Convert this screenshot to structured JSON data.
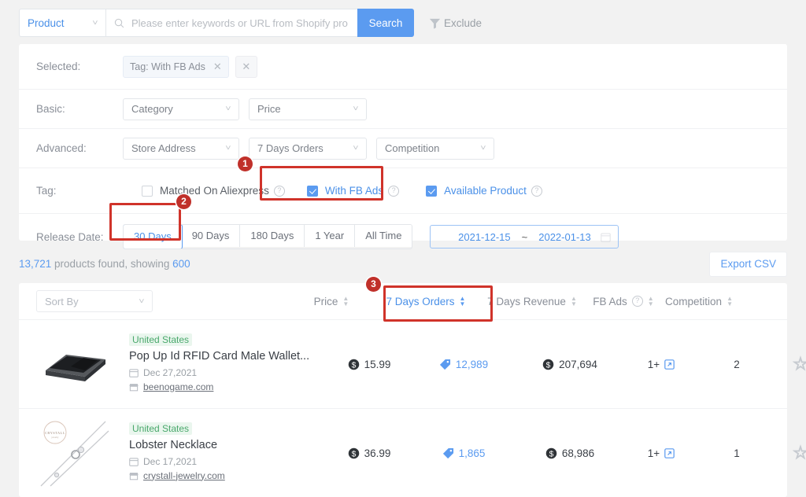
{
  "search": {
    "type_label": "Product",
    "placeholder": "Please enter keywords or URL from Shopify product",
    "button_label": "Search",
    "exclude_label": "Exclude"
  },
  "filters": {
    "selected_label": "Selected:",
    "selected_chips": [
      {
        "label": "Tag: With FB Ads"
      }
    ],
    "basic_label": "Basic:",
    "basic_dropdowns": [
      "Category",
      "Price"
    ],
    "advanced_label": "Advanced:",
    "advanced_dropdowns": [
      "Store Address",
      "7 Days Orders",
      "Competition"
    ],
    "tag_label": "Tag:",
    "tag_checkboxes": [
      {
        "label": "Matched On Aliexpress",
        "checked": false,
        "help": true
      },
      {
        "label": "With FB Ads",
        "checked": true,
        "help": true
      },
      {
        "label": "Available Product",
        "checked": true,
        "help": true
      }
    ],
    "release_label": "Release Date:",
    "release_options": [
      "30 Days",
      "90 Days",
      "180 Days",
      "1 Year",
      "All Time"
    ],
    "release_active": "30 Days",
    "date_from": "2021-12-15",
    "date_to": "2022-01-13",
    "date_separator": "~"
  },
  "results": {
    "count": "13,721",
    "count_text_mid": " products found, showing ",
    "showing": "600",
    "export_label": "Export CSV"
  },
  "table": {
    "sort_by_placeholder": "Sort By",
    "columns": [
      {
        "label": "Price",
        "sorted": false
      },
      {
        "label": "7 Days Orders",
        "sorted": true
      },
      {
        "label": "7 Days Revenue",
        "sorted": false
      },
      {
        "label": "FB Ads",
        "sorted": false,
        "help": true
      },
      {
        "label": "Competition",
        "sorted": false
      }
    ],
    "rows": [
      {
        "country": "United States",
        "title": "Pop Up Id RFID Card Male Wallet...",
        "date": "Dec 27,2021",
        "store": "beenogame.com",
        "price": "15.99",
        "orders": "12,989",
        "revenue": "207,694",
        "fb_ads": "1+",
        "competition": "2",
        "thumb": "wallet"
      },
      {
        "country": "United States",
        "title": "Lobster Necklace",
        "date": "Dec 17,2021",
        "store": "crystall-jewelry.com",
        "price": "36.99",
        "orders": "1,865",
        "revenue": "68,986",
        "fb_ads": "1+",
        "competition": "1",
        "thumb": "necklace"
      }
    ]
  },
  "annotations": [
    {
      "number": "1"
    },
    {
      "number": "2"
    },
    {
      "number": "3"
    }
  ],
  "colors": {
    "accent_blue": "#5b9bf0",
    "link_blue": "#4a90e8",
    "annotation_red": "#c0302a",
    "country_green": "#49a86b"
  }
}
